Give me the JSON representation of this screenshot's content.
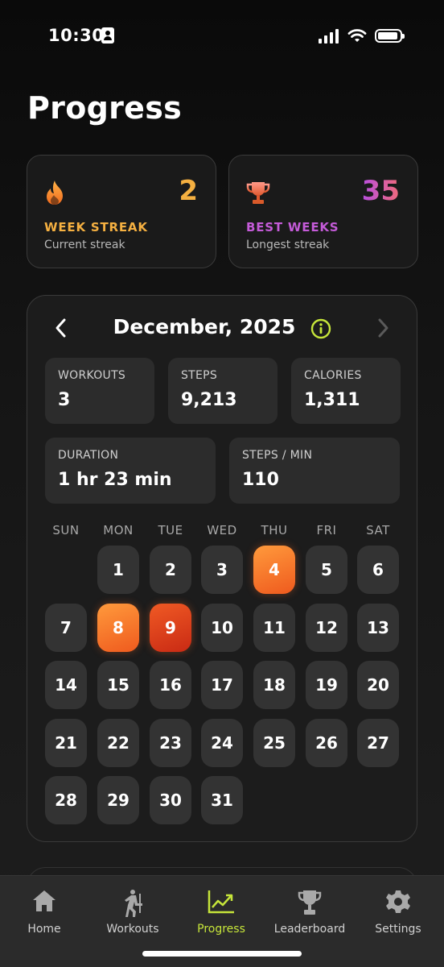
{
  "status_bar": {
    "time": "10:30"
  },
  "page": {
    "title": "Progress"
  },
  "streak_cards": [
    {
      "icon": "flame-icon",
      "value": "2",
      "label": "WEEK STREAK",
      "sub": "Current streak",
      "color": "#f5b041"
    },
    {
      "icon": "trophy-icon",
      "value": "35",
      "label": "BEST WEEKS",
      "sub": "Longest streak",
      "color": "#c45bd8"
    }
  ],
  "calendar": {
    "month_title": "December, 2025",
    "metrics": [
      {
        "label": "WORKOUTS",
        "value": "3"
      },
      {
        "label": "STEPS",
        "value": "9,213"
      },
      {
        "label": "CALORIES",
        "value": "1,311"
      },
      {
        "label": "DURATION",
        "value": "1 hr 23 min"
      },
      {
        "label": "STEPS / MIN",
        "value": "110"
      }
    ],
    "weekdays": [
      "SUN",
      "MON",
      "TUE",
      "WED",
      "THU",
      "FRI",
      "SAT"
    ],
    "first_weekday_index": 1,
    "days_in_month": 31,
    "workout_days": [
      4,
      8,
      9
    ]
  },
  "tab_bar": {
    "tabs": [
      {
        "label": "Home",
        "icon": "home-icon"
      },
      {
        "label": "Workouts",
        "icon": "workout-figure-icon"
      },
      {
        "label": "Progress",
        "icon": "chart-trend-icon",
        "active": true
      },
      {
        "label": "Leaderboard",
        "icon": "trophy-icon"
      },
      {
        "label": "Settings",
        "icon": "gear-icon"
      }
    ]
  },
  "colors": {
    "accent_green": "#c6e53a",
    "accent_orange": "#f27a2e",
    "streak_gold": "#f5b041",
    "best_purple": "#c45bd8"
  }
}
